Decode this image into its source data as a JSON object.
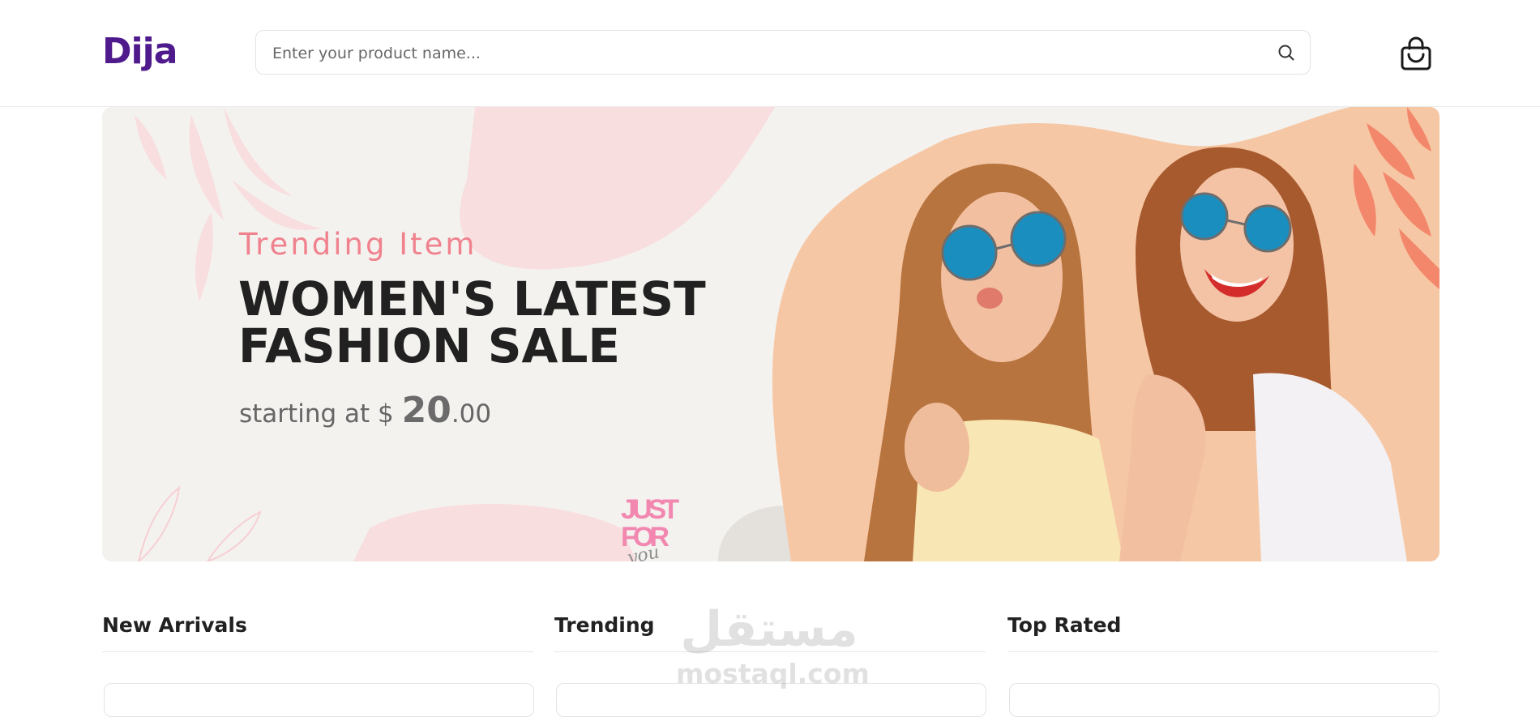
{
  "header": {
    "logo": "Dija",
    "search_placeholder": "Enter your product name...",
    "search_icon": "search-icon",
    "cart_icon": "shopping-bag-icon"
  },
  "banner": {
    "subtitle": "Trending Item",
    "title_line1": "WOMEN'S LATEST",
    "title_line2": "FASHION SALE",
    "price_prefix": "starting at $ ",
    "price_whole": "20",
    "price_cents": ".00",
    "badge_line1": "JUST",
    "badge_line2": "FOR",
    "badge_line3": "you",
    "colors": {
      "accent": "#f0828e",
      "background": "#f4f2ef",
      "peach": "#f6c7a4",
      "brand": "#4e1a8c"
    }
  },
  "sections": [
    {
      "title": "New Arrivals"
    },
    {
      "title": "Trending"
    },
    {
      "title": "Top Rated"
    }
  ],
  "watermark": {
    "arabic": "مستقل",
    "latin": "mostaql.com"
  }
}
